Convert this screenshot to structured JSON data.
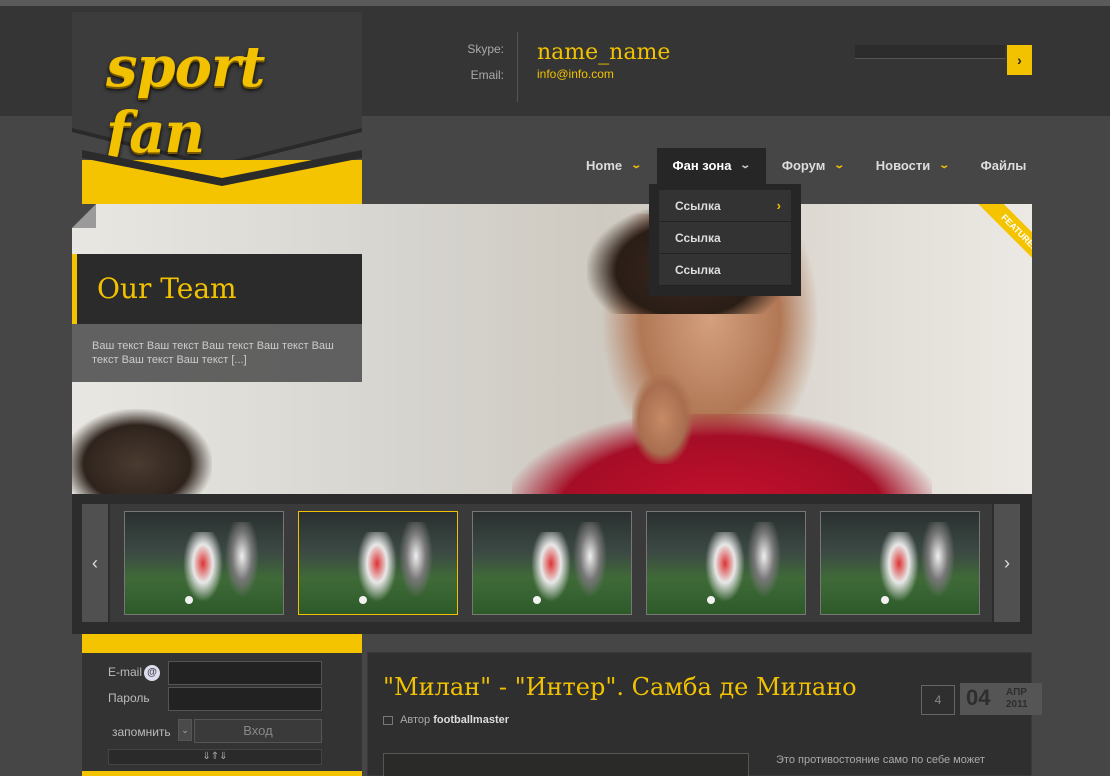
{
  "header": {
    "logo": "sport fan",
    "contact": {
      "skype_label": "Skype:",
      "email_label": "Email:",
      "skype_value": "name_name",
      "email_value": "info@info.com"
    },
    "search": {
      "button_icon": "chevron-right-icon"
    }
  },
  "nav": {
    "items": [
      {
        "label": "Home"
      },
      {
        "label": "Фан зона"
      },
      {
        "label": "Форум"
      },
      {
        "label": "Новости"
      },
      {
        "label": "Файлы"
      }
    ],
    "dropdown": [
      {
        "label": "Ссылка"
      },
      {
        "label": "Ссылка"
      },
      {
        "label": "Ссылка"
      }
    ]
  },
  "slider": {
    "badge": "FEATURED",
    "caption_title": "Our Team",
    "caption_text": "Ваш текст Ваш текст Ваш текст Ваш текст Ваш текст Ваш текст Ваш текст [...]"
  },
  "thumbnails": {
    "count": 5,
    "selected_index": 1
  },
  "login": {
    "email_label": "E-mail",
    "password_label": "Пароль",
    "remember_label": "запомнить",
    "submit_label": "Вход",
    "extra_label": "⇓⇑⇓"
  },
  "article": {
    "title": "\"Милан\" - \"Интер\". Самба де Милано",
    "author_prefix": "Автор",
    "author_name": "footballmaster",
    "comments": "4",
    "date_day": "04",
    "date_month": "АПР",
    "date_year": "2011",
    "excerpt": "Это противостояние само по себе может"
  },
  "colors": {
    "accent": "#f2c200",
    "background": "#464646",
    "header": "#353535"
  }
}
